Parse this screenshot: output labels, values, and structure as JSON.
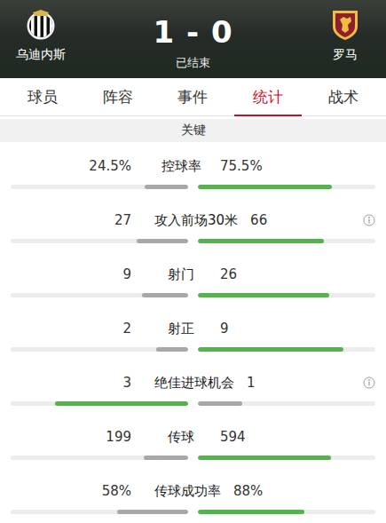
{
  "header": {
    "home": {
      "name": "乌迪内斯"
    },
    "away": {
      "name": "罗马"
    },
    "score": "1 - 0",
    "status": "已结束"
  },
  "tabs": [
    {
      "label": "球员",
      "selected": false
    },
    {
      "label": "阵容",
      "selected": false
    },
    {
      "label": "事件",
      "selected": false
    },
    {
      "label": "统计",
      "selected": true
    },
    {
      "label": "战术",
      "selected": false
    }
  ],
  "section": {
    "title": "关键"
  },
  "stats": [
    {
      "label": "控球率",
      "home": "24.5%",
      "away": "75.5%",
      "home_level": 0.245,
      "away_level": 0.755,
      "home_highlight": false,
      "away_highlight": true,
      "info": false
    },
    {
      "label": "攻入前场30米",
      "home": "27",
      "away": "66",
      "home_level": 0.29,
      "away_level": 0.71,
      "home_highlight": false,
      "away_highlight": true,
      "info": true
    },
    {
      "label": "射门",
      "home": "9",
      "away": "26",
      "home_level": 0.26,
      "away_level": 0.74,
      "home_highlight": false,
      "away_highlight": true,
      "info": false
    },
    {
      "label": "射正",
      "home": "2",
      "away": "9",
      "home_level": 0.18,
      "away_level": 0.82,
      "home_highlight": false,
      "away_highlight": true,
      "info": false
    },
    {
      "label": "绝佳进球机会",
      "home": "3",
      "away": "1",
      "home_level": 0.75,
      "away_level": 0.25,
      "home_highlight": true,
      "away_highlight": false,
      "info": true
    },
    {
      "label": "传球",
      "home": "199",
      "away": "594",
      "home_level": 0.25,
      "away_level": 0.75,
      "home_highlight": false,
      "away_highlight": true,
      "info": false
    },
    {
      "label": "传球成功率",
      "home": "58%",
      "away": "88%",
      "home_level": 0.4,
      "away_level": 0.6,
      "home_highlight": false,
      "away_highlight": true,
      "info": false
    }
  ]
}
